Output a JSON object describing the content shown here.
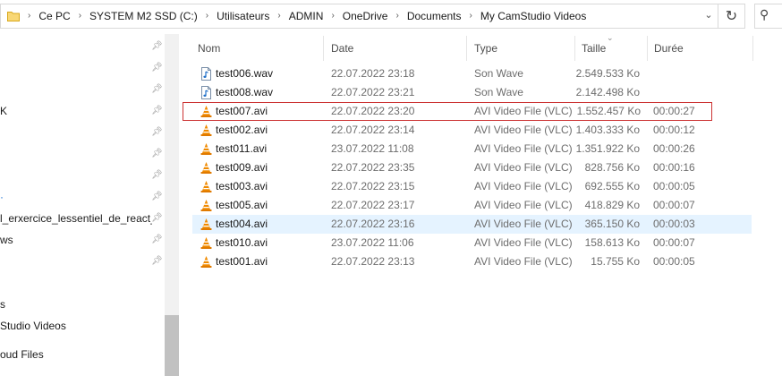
{
  "address": {
    "crumbs": [
      "Ce PC",
      "SYSTEM M2 SSD (C:)",
      "Utilisateurs",
      "ADMIN",
      "OneDrive",
      "Documents",
      "My CamStudio Videos"
    ],
    "separator": "›",
    "dropdown_icon": "chevron-down-icon",
    "refresh_icon": "refresh-icon",
    "search_icon": "search-icon"
  },
  "nav": {
    "items": [
      {
        "label": "",
        "pinned": true
      },
      {
        "label": "",
        "pinned": true
      },
      {
        "label": "K",
        "pinned": true
      },
      {
        "label": "",
        "pinned": true
      },
      {
        "label": "",
        "pinned": true
      },
      {
        "label": "",
        "pinned": true
      },
      {
        "label": "",
        "pinned": true,
        "blue": true
      },
      {
        "label": "l_erxercice_lessentiel_de_react_js",
        "pinned": true
      },
      {
        "label": "ws",
        "pinned": true
      },
      {
        "label": "",
        "pinned": true
      },
      {
        "label": "s",
        "pinned": false
      },
      {
        "label": "Studio Videos",
        "pinned": false
      },
      {
        "label": "oud Files",
        "pinned": false
      }
    ]
  },
  "columns": {
    "name": "Nom",
    "date": "Date",
    "type": "Type",
    "size": "Taille",
    "duration": "Durée"
  },
  "files": [
    {
      "name": "test006.wav",
      "date": "22.07.2022 23:18",
      "type": "Son Wave",
      "size": "2.549.533 Ko",
      "duration": "",
      "icon": "audio-file-icon"
    },
    {
      "name": "test008.wav",
      "date": "22.07.2022 23:21",
      "type": "Son Wave",
      "size": "2.142.498 Ko",
      "duration": "",
      "icon": "audio-file-icon"
    },
    {
      "name": "test007.avi",
      "date": "22.07.2022 23:20",
      "type": "AVI Video File (VLC)",
      "size": "1.552.457 Ko",
      "duration": "00:00:27",
      "icon": "vlc-cone-icon"
    },
    {
      "name": "test002.avi",
      "date": "22.07.2022 23:14",
      "type": "AVI Video File (VLC)",
      "size": "1.403.333 Ko",
      "duration": "00:00:12",
      "icon": "vlc-cone-icon"
    },
    {
      "name": "test011.avi",
      "date": "23.07.2022 11:08",
      "type": "AVI Video File (VLC)",
      "size": "1.351.922 Ko",
      "duration": "00:00:26",
      "icon": "vlc-cone-icon"
    },
    {
      "name": "test009.avi",
      "date": "22.07.2022 23:35",
      "type": "AVI Video File (VLC)",
      "size": "828.756 Ko",
      "duration": "00:00:16",
      "icon": "vlc-cone-icon"
    },
    {
      "name": "test003.avi",
      "date": "22.07.2022 23:15",
      "type": "AVI Video File (VLC)",
      "size": "692.555 Ko",
      "duration": "00:00:05",
      "icon": "vlc-cone-icon"
    },
    {
      "name": "test005.avi",
      "date": "22.07.2022 23:17",
      "type": "AVI Video File (VLC)",
      "size": "418.829 Ko",
      "duration": "00:00:07",
      "icon": "vlc-cone-icon"
    },
    {
      "name": "test004.avi",
      "date": "22.07.2022 23:16",
      "type": "AVI Video File (VLC)",
      "size": "365.150 Ko",
      "duration": "00:00:03",
      "icon": "vlc-cone-icon"
    },
    {
      "name": "test010.avi",
      "date": "23.07.2022 11:06",
      "type": "AVI Video File (VLC)",
      "size": "158.613 Ko",
      "duration": "00:00:07",
      "icon": "vlc-cone-icon"
    },
    {
      "name": "test001.avi",
      "date": "22.07.2022 23:13",
      "type": "AVI Video File (VLC)",
      "size": "15.755 Ko",
      "duration": "00:00:05",
      "icon": "vlc-cone-icon"
    }
  ],
  "state": {
    "highlighted_file": "test007.avi",
    "selected_file": "test004.avi",
    "sorted_by": "size",
    "sort_order": "descending"
  },
  "colors": {
    "selection": "#e5f3ff",
    "highlight_box": "#cc3333",
    "vlc_orange": "#f08a00",
    "link_blue": "#1a6fd1"
  }
}
